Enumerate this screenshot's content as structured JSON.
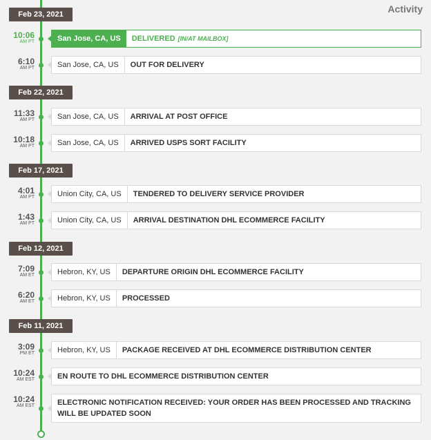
{
  "header": {
    "activity_label": "Activity"
  },
  "colors": {
    "accent": "#4caf50",
    "date_badge": "#5b4f4b"
  },
  "groups": [
    {
      "date": "Feb 23, 2021",
      "events": [
        {
          "time": "10:06",
          "tz": "AM PT",
          "location": "San Jose, CA, US",
          "status": "DELIVERED",
          "sub": "[IN/AT MAILBOX]",
          "active": true
        },
        {
          "time": "6:10",
          "tz": "AM PT",
          "location": "San Jose, CA, US",
          "status": "OUT FOR DELIVERY"
        }
      ]
    },
    {
      "date": "Feb 22, 2021",
      "events": [
        {
          "time": "11:33",
          "tz": "AM PT",
          "location": "San Jose, CA, US",
          "status": "ARRIVAL AT POST OFFICE"
        },
        {
          "time": "10:18",
          "tz": "AM PT",
          "location": "San Jose, CA, US",
          "status": "ARRIVED USPS SORT FACILITY"
        }
      ]
    },
    {
      "date": "Feb 17, 2021",
      "events": [
        {
          "time": "4:01",
          "tz": "AM PT",
          "location": "Union City, CA, US",
          "status": "TENDERED TO DELIVERY SERVICE PROVIDER"
        },
        {
          "time": "1:43",
          "tz": "AM PT",
          "location": "Union City, CA, US",
          "status": "ARRIVAL DESTINATION DHL ECOMMERCE FACILITY"
        }
      ]
    },
    {
      "date": "Feb 12, 2021",
      "events": [
        {
          "time": "7:09",
          "tz": "AM ET",
          "location": "Hebron, KY, US",
          "status": "DEPARTURE ORIGIN DHL ECOMMERCE FACILITY"
        },
        {
          "time": "6:20",
          "tz": "AM ET",
          "location": "Hebron, KY, US",
          "status": "PROCESSED"
        }
      ]
    },
    {
      "date": "Feb 11, 2021",
      "events": [
        {
          "time": "3:09",
          "tz": "PM ET",
          "location": "Hebron, KY, US",
          "status": "PACKAGE RECEIVED AT DHL ECOMMERCE DISTRIBUTION CENTER"
        },
        {
          "time": "10:24",
          "tz": "AM EST",
          "location": "",
          "status": "EN ROUTE TO DHL ECOMMERCE DISTRIBUTION CENTER"
        },
        {
          "time": "10:24",
          "tz": "AM EST",
          "location": "",
          "status": "ELECTRONIC NOTIFICATION RECEIVED: YOUR ORDER HAS BEEN PROCESSED AND TRACKING WILL BE UPDATED SOON"
        }
      ]
    }
  ]
}
